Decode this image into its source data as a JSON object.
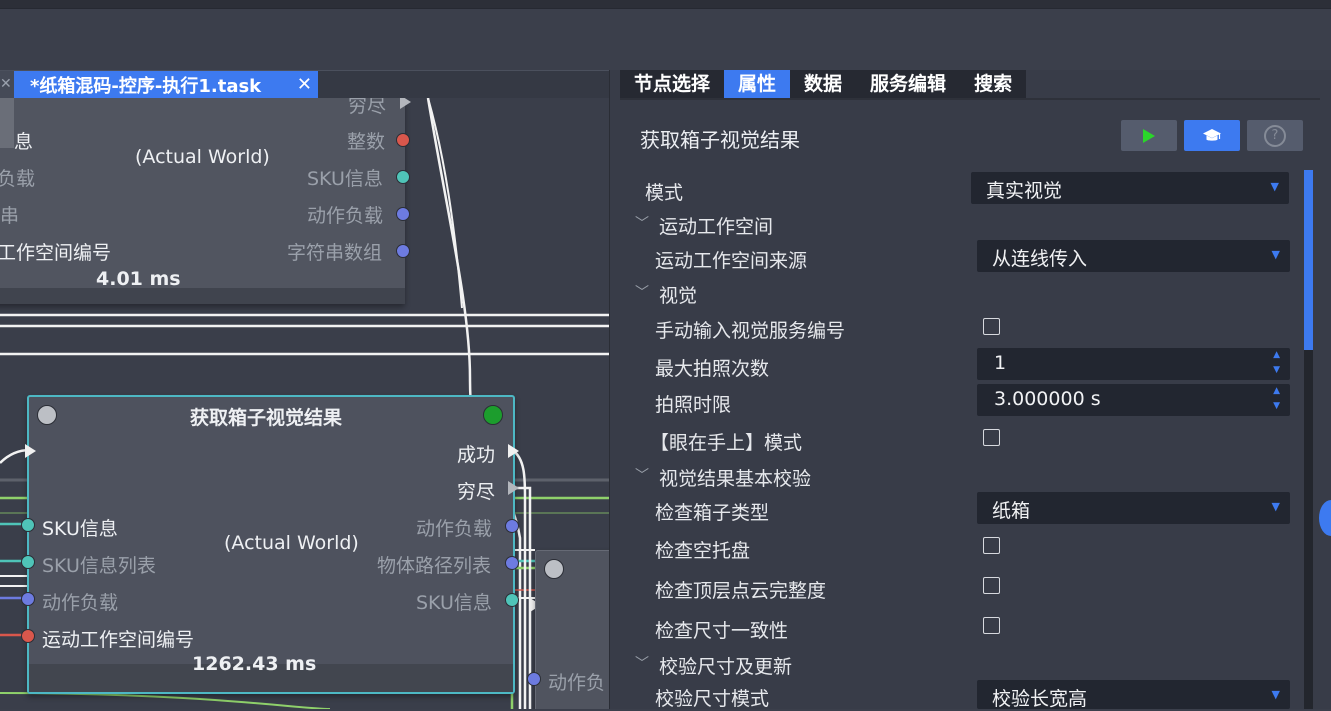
{
  "editor": {
    "tab_title": "*纸箱混码-控序-执行1.task",
    "tab_close": "✕",
    "prev_tab_close": "✕"
  },
  "graph": {
    "node_top": {
      "world_label": "(Actual World)",
      "time": "4.01 ms",
      "outputs": [
        "穷尽",
        "整数",
        "SKU信息",
        "动作负载",
        "字符串数组"
      ],
      "inputs": [
        "息",
        "负载",
        "串",
        "工作空间编号"
      ]
    },
    "node_main": {
      "title": "获取箱子视觉结果",
      "world_label": "(Actual World)",
      "time": "1262.43 ms",
      "outputs": [
        "成功",
        "穷尽",
        "动作负载",
        "物体路径列表",
        "SKU信息"
      ],
      "inputs": [
        "SKU信息",
        "SKU信息列表",
        "动作负载",
        "运动工作空间编号"
      ]
    },
    "node_right": {
      "input": "动作负"
    }
  },
  "panel": {
    "tabs": [
      "节点选择",
      "属性",
      "数据",
      "服务编辑",
      "搜索"
    ],
    "active_tab": 1,
    "title": "获取箱子视觉结果",
    "help_glyph": "?",
    "props": {
      "mode_label": "模式",
      "mode_value": "真实视觉",
      "section_motion": "运动工作空间",
      "motion_source_label": "运动工作空间来源",
      "motion_source_value": "从连线传入",
      "section_vision": "视觉",
      "manual_service_label": "手动输入视觉服务编号",
      "max_shots_label": "最大拍照次数",
      "max_shots_value": "1",
      "time_limit_label": "拍照时限",
      "time_limit_value": "3.000000 s",
      "eye_in_hand_label": "【眼在手上】模式",
      "section_check": "视觉结果基本校验",
      "box_type_label": "检查箱子类型",
      "box_type_value": "纸箱",
      "empty_pallet_label": "检查空托盘",
      "top_cloud_label": "检查顶层点云完整度",
      "size_consistency_label": "检查尺寸一致性",
      "section_size_update": "校验尺寸及更新",
      "size_mode_label": "校验尺寸模式",
      "size_mode_value": "校验长宽高"
    }
  },
  "colors": {
    "accent": "#3d7af0",
    "canvas": "#3a3e4a",
    "panel": "#383c48",
    "node_border": "#4db8c4",
    "port_red": "#d9574c",
    "port_teal": "#4fc4b8",
    "port_blue": "#6d7be0",
    "status_green": "#1c9d2d",
    "wire_green": "#8fd16b"
  }
}
